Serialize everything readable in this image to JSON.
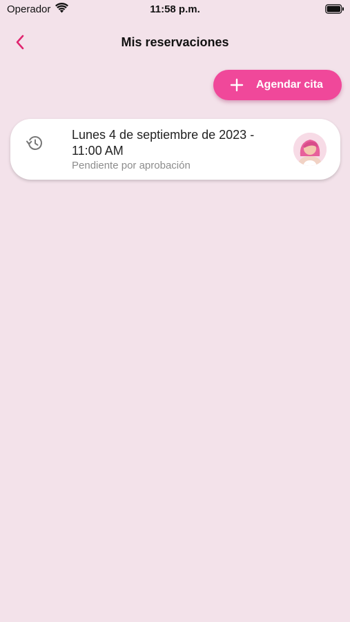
{
  "status_bar": {
    "carrier": "Operador",
    "time": "11:58 p.m."
  },
  "nav": {
    "title": "Mis reservaciones",
    "accent_color": "#e0256f"
  },
  "actions": {
    "add_appointment_label": "Agendar cita",
    "button_color": "#f0489a"
  },
  "reservations": [
    {
      "date_time": "Lunes 4 de septiembre de 2023 - 11:00 AM",
      "status": "Pendiente por aprobación",
      "icon": "history-icon"
    }
  ]
}
